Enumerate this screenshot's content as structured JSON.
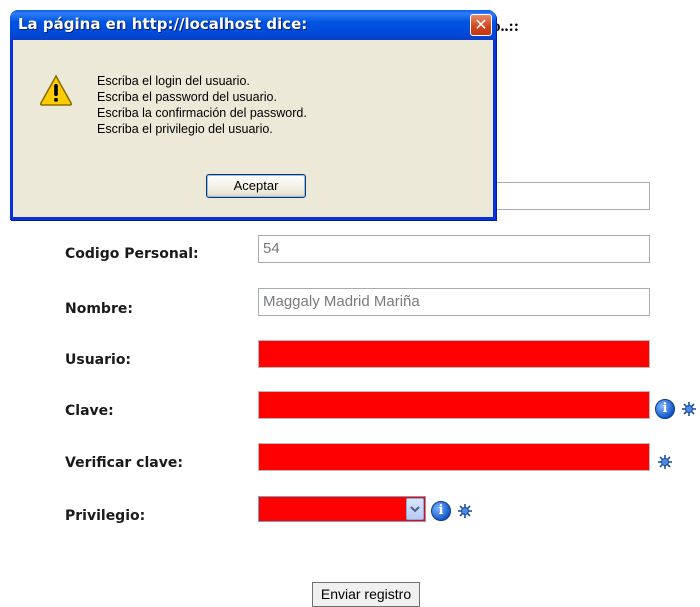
{
  "page": {
    "title_visible": "io..::"
  },
  "form": {
    "codigo_label": "Codigo Personal:",
    "codigo_value": "54",
    "nombre_label": "Nombre:",
    "nombre_value": "Maggaly Madrid Mariña",
    "usuario_label": "Usuario:",
    "clave_label": "Clave:",
    "verificar_label": "Verificar clave:",
    "privilegio_label": "Privilegio:",
    "submit_label": "Enviar registro",
    "error_color": "#ff0000",
    "icons": [
      "info-icon",
      "required-star-icon",
      "chevron-down-icon"
    ]
  },
  "dialog": {
    "title": "La página en http://localhost dice:",
    "icon": "warning-icon",
    "messages": [
      "Escriba el login del usuario.",
      "Escriba el password del usuario.",
      "Escriba la confirmación del password.",
      "Escriba el privilegio del usuario."
    ],
    "ok_label": "Aceptar",
    "titlebar_color": "#0054e3"
  }
}
